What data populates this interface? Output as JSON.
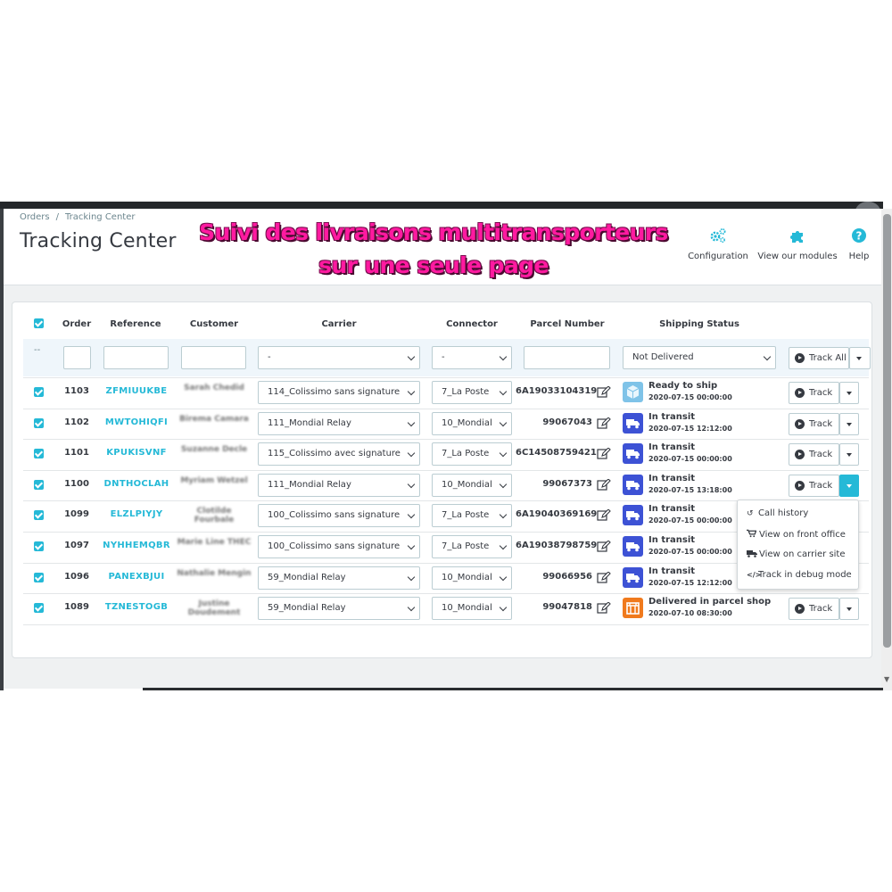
{
  "breadcrumb": {
    "items": [
      "Orders",
      "Tracking Center"
    ],
    "separator": "/"
  },
  "page_title": "Tracking Center",
  "banner": {
    "line1": "Suivi des livraisons multitransporteurs",
    "line2": "sur une seule page",
    "color": "#ff1aa0"
  },
  "header_buttons": [
    {
      "label": "Configuration",
      "icon": "gears-icon"
    },
    {
      "label": "View our modules",
      "icon": "puzzle-icon"
    },
    {
      "label": "Help",
      "icon": "help-circle-icon"
    }
  ],
  "columns": [
    "Order",
    "Reference",
    "Customer",
    "Carrier",
    "Connector",
    "Parcel Number",
    "Shipping Status"
  ],
  "filters": {
    "select_all_placeholder": "--",
    "carrier": "-",
    "connector": "-",
    "shipping_status": "Not Delivered",
    "track_all_label": "Track All"
  },
  "rows": [
    {
      "order": "1103",
      "reference": "ZFMIUUKBE",
      "customer": "Sarah Chedid",
      "carrier": "114_Colissimo sans signature",
      "connector": "7_La Poste",
      "parcel": "6A19033104319",
      "status": "Ready to ship",
      "status_icon": "box-icon",
      "date": "2020-07-15 00:00:00",
      "track_label": "Track"
    },
    {
      "order": "1102",
      "reference": "MWTOHIQFI",
      "customer": "Birema Camara",
      "carrier": "111_Mondial Relay",
      "connector": "10_Mondial",
      "parcel": "99067043",
      "status": "In transit",
      "status_icon": "truck-icon",
      "date": "2020-07-15 12:12:00",
      "track_label": "Track"
    },
    {
      "order": "1101",
      "reference": "KPUKISVNF",
      "customer": "Suzanne Decle",
      "carrier": "115_Colissimo avec signature",
      "connector": "7_La Poste",
      "parcel": "6C14508759421",
      "status": "In transit",
      "status_icon": "truck-icon",
      "date": "2020-07-15 00:00:00",
      "track_label": "Track"
    },
    {
      "order": "1100",
      "reference": "DNTHOCLAH",
      "customer": "Myriam Wetzel",
      "carrier": "111_Mondial Relay",
      "connector": "10_Mondial",
      "parcel": "99067373",
      "status": "In transit",
      "status_icon": "truck-icon",
      "date": "2020-07-15 13:18:00",
      "track_label": "Track"
    },
    {
      "order": "1099",
      "reference": "ELZLPIYJY",
      "customer": "Clotilde Fourbale",
      "carrier": "100_Colissimo sans signature",
      "connector": "7_La Poste",
      "parcel": "6A19040369169",
      "status": "In transit",
      "status_icon": "truck-icon",
      "date": "2020-07-15 00:00:00",
      "track_label": "Track"
    },
    {
      "order": "1097",
      "reference": "NYHHEMQBR",
      "customer": "Marie Line THEC",
      "carrier": "100_Colissimo sans signature",
      "connector": "7_La Poste",
      "parcel": "6A19038798759",
      "status": "In transit",
      "status_icon": "truck-icon",
      "date": "2020-07-15 00:00:00",
      "track_label": "Track"
    },
    {
      "order": "1096",
      "reference": "PANEXBJUI",
      "customer": "Nathalie Mengin",
      "carrier": "59_Mondial Relay",
      "connector": "10_Mondial",
      "parcel": "99066956",
      "status": "In transit",
      "status_icon": "truck-icon",
      "date": "2020-07-15 12:12:00",
      "track_label": "Track"
    },
    {
      "order": "1089",
      "reference": "TZNESTOGB",
      "customer": "Justine Doudement",
      "carrier": "59_Mondial Relay",
      "connector": "10_Mondial",
      "parcel": "99047818",
      "status": "Delivered in parcel shop",
      "status_icon": "shop-icon",
      "date": "2020-07-10 08:30:00",
      "track_label": "Track"
    }
  ],
  "dropdown": {
    "items": [
      {
        "label": "Call history",
        "icon": "history-icon"
      },
      {
        "label": "View on front office",
        "icon": "cart-icon"
      },
      {
        "label": "View on carrier site",
        "icon": "truck-icon"
      },
      {
        "label": "Track in debug mode",
        "icon": "code-icon"
      }
    ]
  },
  "colors": {
    "accent": "#25b9d7",
    "transit": "#3d52d5",
    "ready": "#7fc3e8",
    "shop": "#f07a1d"
  }
}
